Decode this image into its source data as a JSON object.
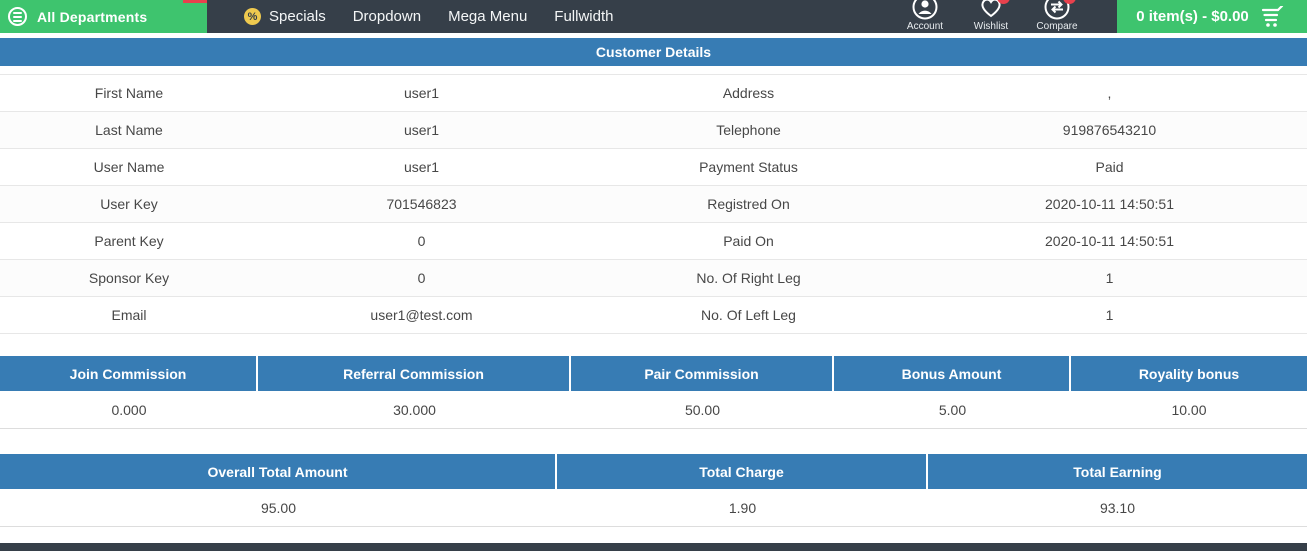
{
  "colors": {
    "nav_dark": "#363f49",
    "accent_green": "#3ec46e",
    "header_blue": "#377cb4",
    "badge_red": "#e8414d",
    "specials_yellow": "#efca4f"
  },
  "nav": {
    "all_departments": "All Departments",
    "menu": [
      {
        "label": "Specials"
      },
      {
        "label": "Dropdown"
      },
      {
        "label": "Mega Menu"
      },
      {
        "label": "Fullwidth"
      }
    ],
    "account_label": "Account",
    "wishlist_label": "Wishlist",
    "compare_label": "Compare",
    "cart_summary": "0 item(s) - $0.00"
  },
  "customer": {
    "title": "Customer Details",
    "rows": [
      {
        "label1": "First Name",
        "value1": "user1",
        "label2": "Address",
        "value2": ","
      },
      {
        "label1": "Last Name",
        "value1": "user1",
        "label2": "Telephone",
        "value2": "919876543210"
      },
      {
        "label1": "User Name",
        "value1": "user1",
        "label2": "Payment Status",
        "value2": "Paid"
      },
      {
        "label1": "User Key",
        "value1": "701546823",
        "label2": "Registred On",
        "value2": "2020-10-11 14:50:51"
      },
      {
        "label1": "Parent Key",
        "value1": "0",
        "label2": "Paid On",
        "value2": "2020-10-11 14:50:51"
      },
      {
        "label1": "Sponsor Key",
        "value1": "0",
        "label2": "No. Of Right Leg",
        "value2": "1"
      },
      {
        "label1": "Email",
        "value1": "user1@test.com",
        "label2": "No. Of Left Leg",
        "value2": "1"
      }
    ]
  },
  "commissions": {
    "headers": [
      "Join Commission",
      "Referral Commission",
      "Pair Commission",
      "Bonus Amount",
      "Royality bonus"
    ],
    "values": [
      "0.000",
      "30.000",
      "50.00",
      "5.00",
      "10.00"
    ]
  },
  "totals": {
    "headers": [
      "Overall Total Amount",
      "Total Charge",
      "Total Earning"
    ],
    "values": [
      "95.00",
      "1.90",
      "93.10"
    ]
  }
}
